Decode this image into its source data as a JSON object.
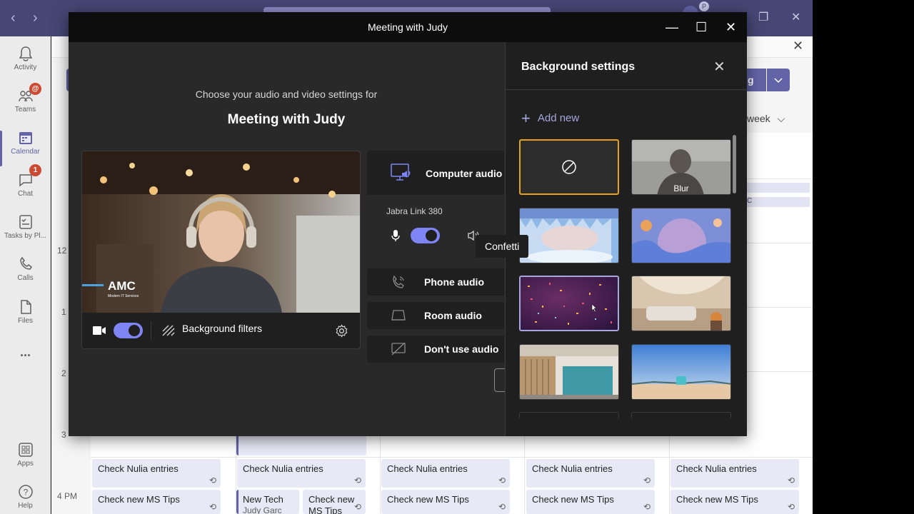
{
  "window": {
    "title": "Meeting with Judy",
    "controls": {
      "minimize": "—",
      "maximize": "☐",
      "close": "✕"
    }
  },
  "teams": {
    "rail": [
      {
        "label": "Activity",
        "icon": "bell-icon",
        "badge": ""
      },
      {
        "label": "Teams",
        "icon": "teams-icon",
        "badge": "@"
      },
      {
        "label": "Calendar",
        "icon": "calendar-icon",
        "badge": ""
      },
      {
        "label": "Chat",
        "icon": "chat-icon",
        "badge": "1"
      },
      {
        "label": "Tasks by Pl...",
        "icon": "tasks-icon",
        "badge": ""
      },
      {
        "label": "Calls",
        "icon": "phone-icon",
        "badge": ""
      },
      {
        "label": "Files",
        "icon": "file-icon",
        "badge": ""
      },
      {
        "label": "...",
        "icon": "more-icon",
        "badge": ""
      },
      {
        "label": "Apps",
        "icon": "apps-icon",
        "badge": ""
      },
      {
        "label": "Help",
        "icon": "help-icon",
        "badge": ""
      }
    ],
    "join_label": "g",
    "week_label": "week",
    "right_event_letter": "C",
    "hours": [
      "12",
      "1",
      "2",
      "3",
      "4 PM"
    ],
    "events": {
      "nulia": "Check Nulia entries",
      "ms_tips": "Check new MS Tips",
      "new_tech": "New Tech",
      "new_tech_sub": "Judy Garc",
      "check_new": "Check new",
      "ms_tips_short": "MS Tips"
    },
    "avatar_initial": "P"
  },
  "prejoin": {
    "subheading": "Choose your audio and video settings for",
    "meeting_title": "Meeting with Judy",
    "background_filters_label": "Background filters",
    "video_logo_text": "AMC",
    "video_logo_sub": "Modern IT Services",
    "camera_on": true,
    "audio_options": {
      "computer": "Computer audio",
      "device": "Jabra Link 380",
      "phone": "Phone audio",
      "room": "Room audio",
      "none": "Don't use audio"
    },
    "mic_on": true
  },
  "background_panel": {
    "title": "Background settings",
    "add_new": "Add new",
    "thumbnails": [
      {
        "name": "None",
        "label": "",
        "selected": true
      },
      {
        "name": "Blur",
        "label": "Blur",
        "selected": false
      },
      {
        "name": "Ice cave",
        "label": "",
        "selected": false
      },
      {
        "name": "Fantasy",
        "label": "",
        "selected": false
      },
      {
        "name": "Confetti",
        "label": "",
        "selected": false
      },
      {
        "name": "Cozy room",
        "label": "",
        "selected": false
      },
      {
        "name": "Office",
        "label": "",
        "selected": false
      },
      {
        "name": "Beach",
        "label": "",
        "selected": false
      }
    ],
    "tooltip": "Confetti"
  },
  "colors": {
    "accent": "#6264a7",
    "toggle_on": "#7f85f5",
    "selected_border": "#e3a21a"
  }
}
